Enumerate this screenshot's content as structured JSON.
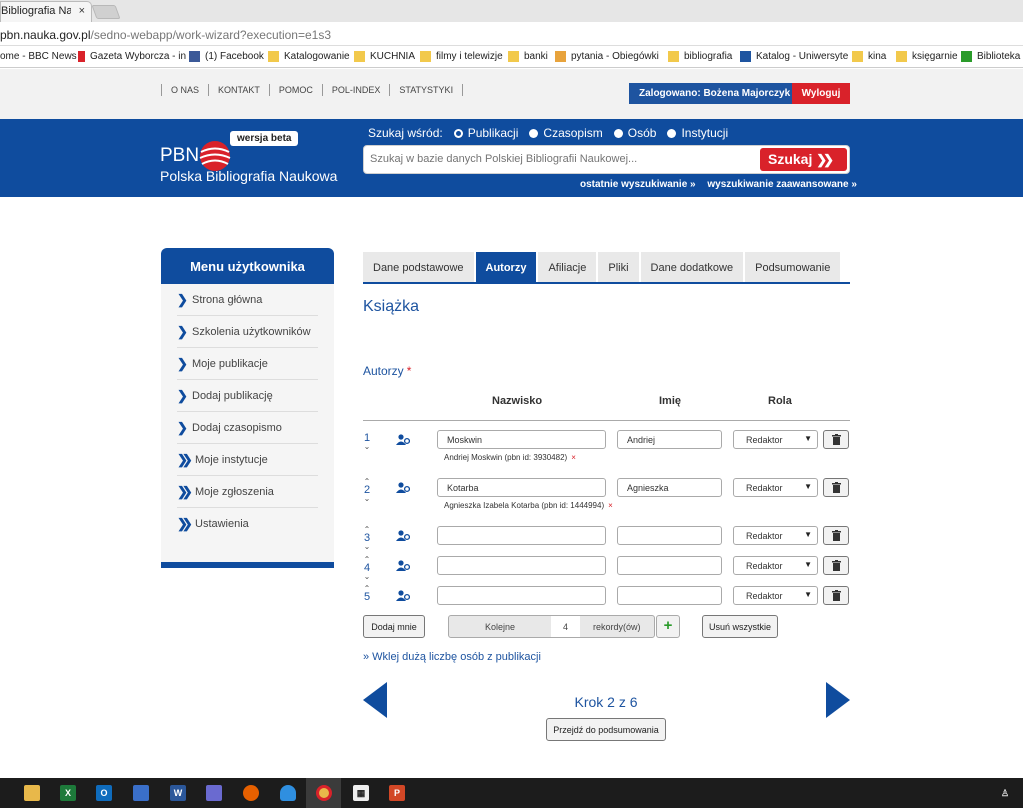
{
  "browser": {
    "tab_title": "Bibliografia Nauk...",
    "tab_close": "×",
    "url_host": "pbn.nauka.gov.pl",
    "url_path": "/sedno-webapp/work-wizard?execution=e1s3",
    "bookmarks": [
      {
        "label": "ome - BBC News",
        "color": "#ffffff"
      },
      {
        "label": "Gazeta Wyborcza - in",
        "color": "#d9222a"
      },
      {
        "label": "(1) Facebook",
        "color": "#3b5998"
      },
      {
        "label": "Katalogowanie",
        "color": "#f2c94c"
      },
      {
        "label": "KUCHNIA",
        "color": "#f2c94c"
      },
      {
        "label": "filmy i telewizje",
        "color": "#f2c94c"
      },
      {
        "label": "banki",
        "color": "#f2c94c"
      },
      {
        "label": "pytania - Obiegówki",
        "color": "#e8a33c"
      },
      {
        "label": "bibliografia",
        "color": "#f2c94c"
      },
      {
        "label": "Katalog - Uniwersyte",
        "color": "#1e54a0"
      },
      {
        "label": "kina",
        "color": "#f2c94c"
      },
      {
        "label": "księgarnie",
        "color": "#f2c94c"
      },
      {
        "label": "Biblioteka U",
        "color": "#2a9b2a"
      }
    ]
  },
  "topbar": {
    "nav": [
      "O NAS",
      "KONTAKT",
      "POMOC",
      "POL-INDEX",
      "STATYSTYKI"
    ],
    "logged_in": "Zalogowano: Bożena Majorczyk",
    "logout": "Wyloguj"
  },
  "header": {
    "logo_pbn": "PBN",
    "logo_name": "Polska Bibliografia Naukowa",
    "beta": "wersja beta",
    "search_in": "Szukaj wśród:",
    "options": [
      "Publikacji",
      "Czasopism",
      "Osób",
      "Instytucji"
    ],
    "selected_option": "Publikacji",
    "search_placeholder": "Szukaj w bazie danych Polskiej Bibliografii Naukowej...",
    "search_button": "Szukaj",
    "link_recent": "ostatnie wyszukiwanie »",
    "link_advanced": "wyszukiwanie zaawansowane »"
  },
  "sidebar": {
    "title": "Menu użytkownika",
    "items": [
      {
        "label": "Strona główna"
      },
      {
        "label": "Szkolenia użytkowników"
      },
      {
        "label": "Moje publikacje"
      },
      {
        "label": "Dodaj publikację"
      },
      {
        "label": "Dodaj czasopismo"
      },
      {
        "label": "Moje instytucje"
      },
      {
        "label": "Moje zgłoszenia"
      },
      {
        "label": "Ustawienia"
      }
    ]
  },
  "wizard": {
    "tabs": [
      "Dane podstawowe",
      "Autorzy",
      "Afiliacje",
      "Pliki",
      "Dane dodatkowe",
      "Podsumowanie"
    ],
    "active_tab": "Autorzy",
    "page_title": "Książka",
    "section_label": "Autorzy",
    "required_mark": "*",
    "columns": {
      "surname": "Nazwisko",
      "name": "Imię",
      "role": "Rola"
    },
    "rows": [
      {
        "num": "1",
        "surname": "Moskwin",
        "name": "Andriej",
        "role": "Redaktor",
        "note": "Andriej Moskwin (pbn id: 3930482)"
      },
      {
        "num": "2",
        "surname": "Kotarba",
        "name": "Agnieszka",
        "role": "Redaktor",
        "note": "Agnieszka Izabela Kotarba (pbn id: 1444994)"
      },
      {
        "num": "3",
        "surname": "",
        "name": "",
        "role": "Redaktor",
        "note": ""
      },
      {
        "num": "4",
        "surname": "",
        "name": "",
        "role": "Redaktor",
        "note": ""
      },
      {
        "num": "5",
        "surname": "",
        "name": "",
        "role": "Redaktor",
        "note": ""
      }
    ],
    "note_remove": "×",
    "add_me": "Dodaj mnie",
    "counter_label": "Kolejne",
    "counter_value": "4",
    "counter_suffix": "rekordy(ów)",
    "plus": "+",
    "remove_all": "Usuń wszystkie",
    "paste_link": "» Wklej dużą liczbę osób z publikacji",
    "step": "Krok 2 z 6",
    "go_summary": "Przejdź do podsumowania"
  },
  "colors": {
    "brand_blue": "#0f4c9e",
    "accent_red": "#d9222a"
  }
}
